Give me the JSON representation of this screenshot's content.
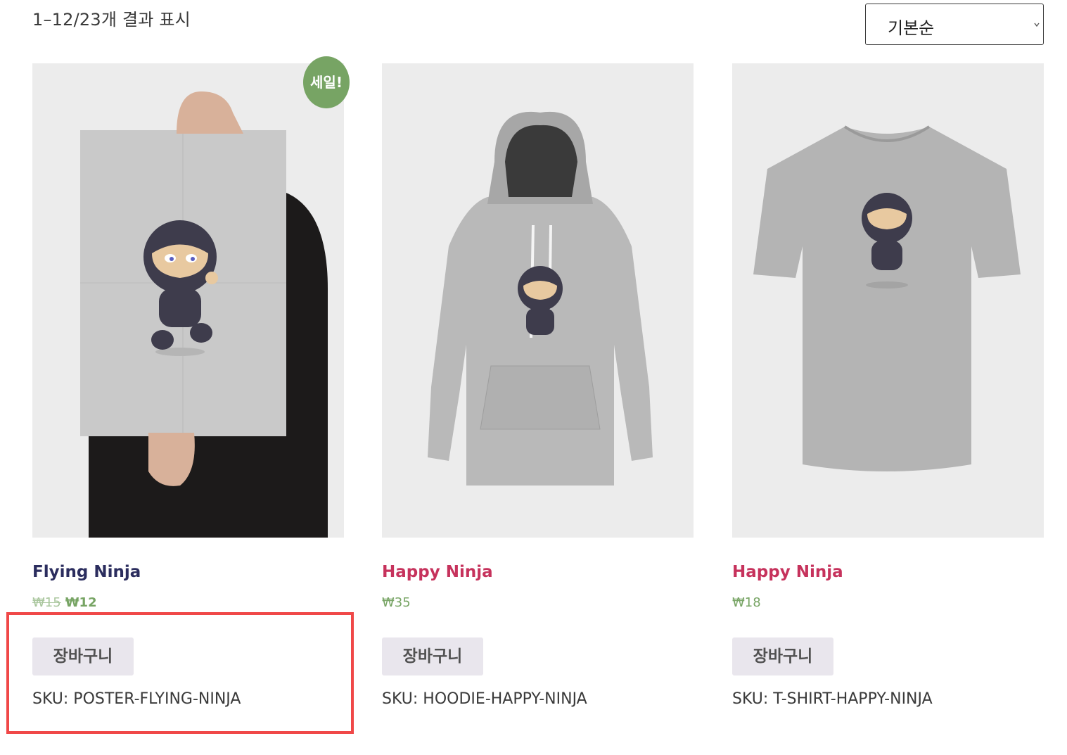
{
  "toolbar": {
    "result_count": "1–12/23개 결과 표시",
    "orderby_selected": "기본순"
  },
  "products": [
    {
      "title": "Flying Ninja",
      "title_color": "#2b2d5e",
      "price_regular": "₩15",
      "price_sale": "₩12",
      "badge": "세일!",
      "add_to_cart": "장바구니",
      "sku": "SKU: POSTER-FLYING-NINJA",
      "image": "poster-ninja"
    },
    {
      "title": "Happy Ninja",
      "title_color": "#c6325c",
      "price": "₩35",
      "add_to_cart": "장바구니",
      "sku": "SKU: HOODIE-HAPPY-NINJA",
      "image": "hoodie-ninja"
    },
    {
      "title": "Happy Ninja",
      "title_color": "#c6325c",
      "price": "₩18",
      "add_to_cart": "장바구니",
      "sku": "SKU: T-SHIRT-HAPPY-NINJA",
      "image": "tshirt-ninja"
    }
  ],
  "colors": {
    "accent_price": "#77a464",
    "sale_badge": "#77a464",
    "highlight_border": "#f04848",
    "button_bg": "#e9e6ed"
  }
}
